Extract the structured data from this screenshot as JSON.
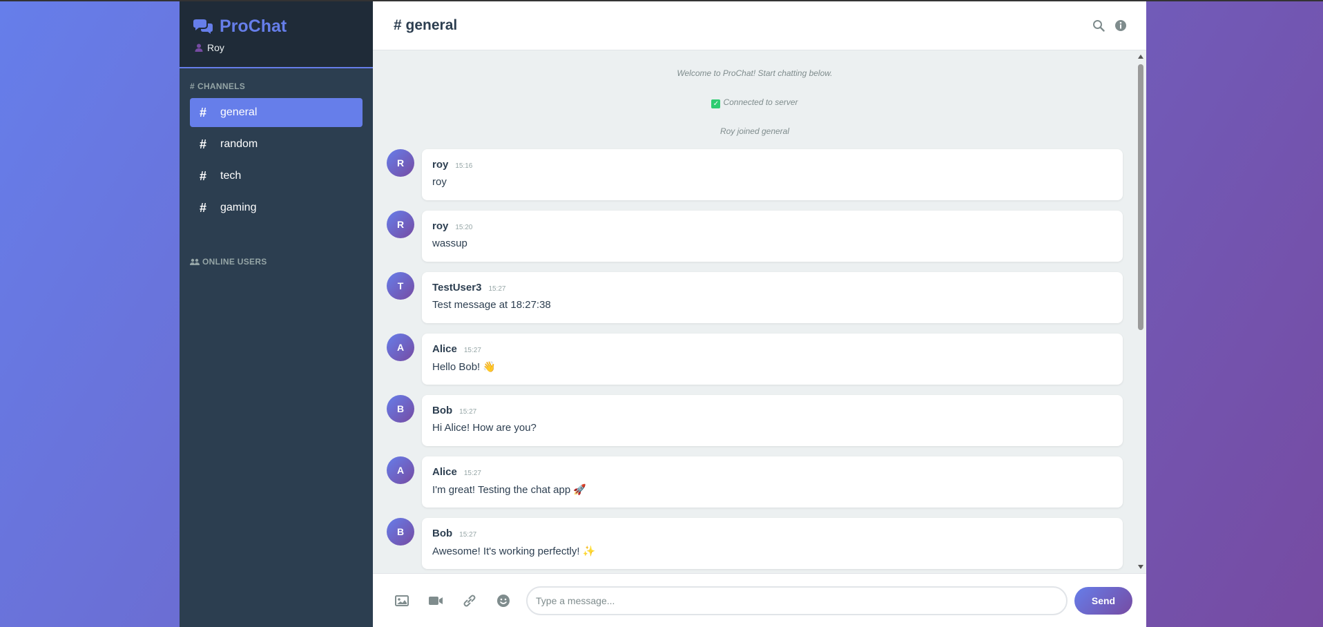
{
  "app": {
    "title": "ProChat",
    "user": "Roy"
  },
  "sidebar": {
    "channels_title": "CHANNELS",
    "channels": [
      {
        "name": "general",
        "active": true
      },
      {
        "name": "random"
      },
      {
        "name": "tech"
      },
      {
        "name": "gaming"
      }
    ],
    "online_title": "ONLINE USERS"
  },
  "header": {
    "title": "# general"
  },
  "system_messages": [
    "Welcome to ProChat! Start chatting below.",
    "Connected to server",
    "Roy joined general"
  ],
  "messages": [
    {
      "initial": "R",
      "author": "roy",
      "time": "15:16",
      "text": "roy"
    },
    {
      "initial": "R",
      "author": "roy",
      "time": "15:20",
      "text": "wassup"
    },
    {
      "initial": "T",
      "author": "TestUser3",
      "time": "15:27",
      "text": "Test message at 18:27:38"
    },
    {
      "initial": "A",
      "author": "Alice",
      "time": "15:27",
      "text": "Hello Bob! 👋"
    },
    {
      "initial": "B",
      "author": "Bob",
      "time": "15:27",
      "text": "Hi Alice! How are you?"
    },
    {
      "initial": "A",
      "author": "Alice",
      "time": "15:27",
      "text": "I'm great! Testing the chat app 🚀"
    },
    {
      "initial": "B",
      "author": "Bob",
      "time": "15:27",
      "text": "Awesome! It's working perfectly! ✨"
    }
  ],
  "composer": {
    "placeholder": "Type a message...",
    "send_label": "Send"
  },
  "colors": {
    "accent": "#667eea",
    "accent2": "#764ba2",
    "sidebar": "#2c3e50"
  }
}
